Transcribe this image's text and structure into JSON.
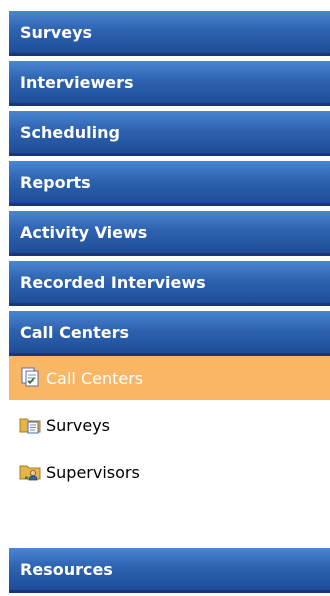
{
  "menu": {
    "headers": [
      {
        "label": "Surveys"
      },
      {
        "label": "Interviewers"
      },
      {
        "label": "Scheduling"
      },
      {
        "label": "Reports"
      },
      {
        "label": "Activity Views"
      },
      {
        "label": "Recorded Interviews"
      },
      {
        "label": "Call Centers"
      }
    ],
    "call_centers_items": [
      {
        "label": "Call Centers",
        "icon": "call-centers-icon",
        "active": true
      },
      {
        "label": "Surveys",
        "icon": "surveys-folder-icon",
        "active": false
      },
      {
        "label": "Supervisors",
        "icon": "supervisors-folder-icon",
        "active": false
      }
    ],
    "bottom_header": {
      "label": "Resources"
    }
  },
  "colors": {
    "header_top": "#4a86d2",
    "header_bottom": "#1e4d98",
    "active_item": "#f9b766",
    "folder": "#e6b54a"
  }
}
